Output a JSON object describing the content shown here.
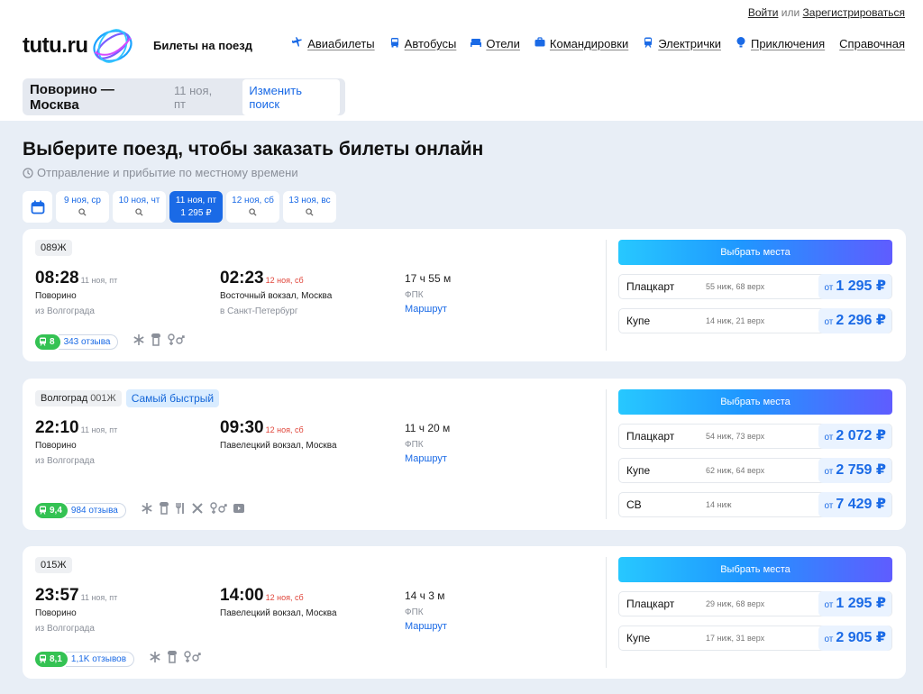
{
  "auth": {
    "login": "Войти",
    "or": "или",
    "register": "Зарегистрироваться"
  },
  "logo": {
    "text": "tutu.ru"
  },
  "header": {
    "section": "Билеты на поезд"
  },
  "nav": [
    {
      "label": "Авиабилеты",
      "icon": "plane-icon"
    },
    {
      "label": "Автобусы",
      "icon": "bus-icon"
    },
    {
      "label": "Отели",
      "icon": "bed-icon"
    },
    {
      "label": "Командировки",
      "icon": "briefcase-icon"
    },
    {
      "label": "Электрички",
      "icon": "train-icon"
    },
    {
      "label": "Приключения",
      "icon": "balloon-icon"
    },
    {
      "label": "Справочная",
      "icon": ""
    }
  ],
  "search": {
    "route": "Поворино — Москва",
    "date": "11 ноя, пт",
    "change": "Изменить поиск"
  },
  "main": {
    "title": "Выберите поезд, чтобы заказать билеты онлайн",
    "subtitle": "Отправление и прибытие по местному времени"
  },
  "dates": [
    {
      "label": "9 ноя, ср",
      "sub": "🔍",
      "active": false
    },
    {
      "label": "10 ноя, чт",
      "sub": "🔍",
      "active": false
    },
    {
      "label": "11 ноя, пт",
      "sub": "1 295 ₽",
      "active": true
    },
    {
      "label": "12 ноя, сб",
      "sub": "🔍",
      "active": false
    },
    {
      "label": "13 ноя, вс",
      "sub": "🔍",
      "active": false
    }
  ],
  "trains": [
    {
      "name": "",
      "number": "089Ж",
      "badge": "",
      "dep_time": "08:28",
      "dep_date": "11 ноя, пт",
      "dep_station": "Поворино",
      "dep_from": "из Волгограда",
      "arr_time": "02:23",
      "arr_date": "12 ноя, сб",
      "arr_station": "Восточный вокзал, Москва",
      "arr_to": "в Санкт-Петербург",
      "duration": "17 ч 55 м",
      "carrier": "ФПК",
      "route_link": "Маршрут",
      "rating": "8",
      "reviews": "343 отзыва",
      "button": "Выбрать места",
      "fares": [
        {
          "class": "Плацкарт",
          "seats": "55 ниж, 68 верх",
          "ot": "от",
          "price": "1 295 ₽"
        },
        {
          "class": "Купе",
          "seats": "14 ниж, 21 верх",
          "ot": "от",
          "price": "2 296 ₽"
        }
      ]
    },
    {
      "name": "Волгоград",
      "number": "001Ж",
      "badge": "Самый быстрый",
      "dep_time": "22:10",
      "dep_date": "11 ноя, пт",
      "dep_station": "Поворино",
      "dep_from": "из Волгограда",
      "arr_time": "09:30",
      "arr_date": "12 ноя, сб",
      "arr_station": "Павелецкий вокзал, Москва",
      "arr_to": "",
      "duration": "11 ч 20 м",
      "carrier": "ФПК",
      "route_link": "Маршрут",
      "rating": "9,4",
      "reviews": "984 отзыва",
      "button": "Выбрать места",
      "fares": [
        {
          "class": "Плацкарт",
          "seats": "54 ниж, 73 верх",
          "ot": "от",
          "price": "2 072 ₽"
        },
        {
          "class": "Купе",
          "seats": "62 ниж, 64 верх",
          "ot": "от",
          "price": "2 759 ₽"
        },
        {
          "class": "СВ",
          "seats": "14 ниж",
          "ot": "от",
          "price": "7 429 ₽"
        }
      ]
    },
    {
      "name": "",
      "number": "015Ж",
      "badge": "",
      "dep_time": "23:57",
      "dep_date": "11 ноя, пт",
      "dep_station": "Поворино",
      "dep_from": "из Волгограда",
      "arr_time": "14:00",
      "arr_date": "12 ноя, сб",
      "arr_station": "Павелецкий вокзал, Москва",
      "arr_to": "",
      "duration": "14 ч 3 м",
      "carrier": "ФПК",
      "route_link": "Маршрут",
      "rating": "8,1",
      "reviews": "1,1K отзывов",
      "button": "Выбрать места",
      "fares": [
        {
          "class": "Плацкарт",
          "seats": "29 ниж, 68 верх",
          "ot": "от",
          "price": "1 295 ₽"
        },
        {
          "class": "Купе",
          "seats": "17 ниж, 31 верх",
          "ot": "от",
          "price": "2 905 ₽"
        }
      ]
    }
  ],
  "colors": {
    "accent": "#1a6ae6",
    "rating": "#34c253",
    "late_date": "#e0453a",
    "background": "#e8eef6"
  }
}
